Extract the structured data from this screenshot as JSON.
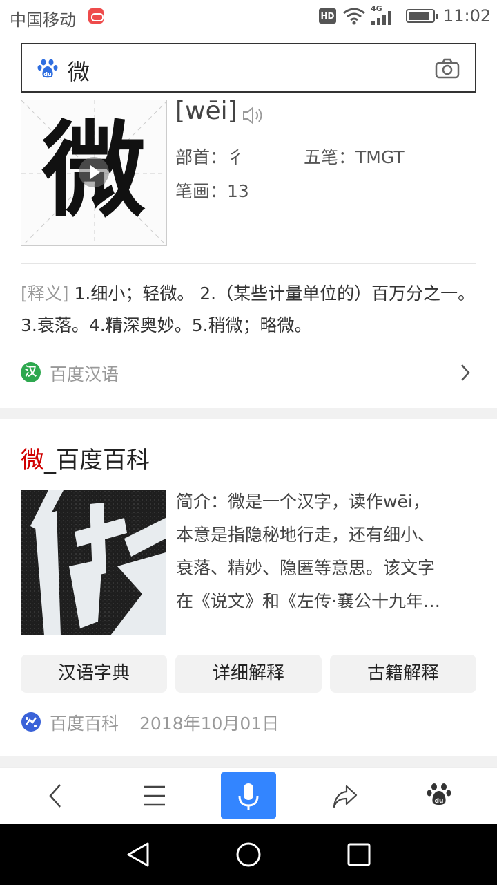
{
  "status_bar": {
    "carrier": "中国移动",
    "hd": "HD",
    "network": "4G",
    "time": "11:02"
  },
  "search": {
    "query": "微",
    "logo_icon": "baidu-paw-icon",
    "camera_icon": "camera-icon"
  },
  "dictionary": {
    "character": "微",
    "pinyin": "[wēi]",
    "radical_label": "部首：",
    "radical": "彳",
    "wubi_label": "五笔：",
    "wubi": "TMGT",
    "strokes_label": "笔画：",
    "strokes": "13",
    "definition_tag": "[释义]",
    "definition": " 1.细小；轻微。 2.（某些计量单位的）百万分之一。3.衰落。4.精深奥妙。5.稍微；略微。",
    "source_badge": "汉",
    "source": "百度汉语"
  },
  "baike": {
    "title_highlight": "微",
    "title_rest": "_百度百科",
    "intro_lines": [
      "简介：微是一个汉字，读作wēi，",
      "本意是指隐秘地行走，还有细小、",
      "衰落、精妙、隐匿等意思。该文字",
      "在《说文》和《左传·襄公十九年…"
    ],
    "buttons": [
      "汉语字典",
      "详细解释",
      "古籍解释"
    ],
    "source": "百度百科",
    "date": "2018年10月01日"
  },
  "toolbar": {
    "items": [
      "back-icon",
      "menu-icon",
      "microphone-icon",
      "share-icon",
      "baidu-paw-icon"
    ]
  },
  "colors": {
    "accent": "#3385ff",
    "highlight": "#d00000",
    "green_badge": "#2ea84f"
  }
}
